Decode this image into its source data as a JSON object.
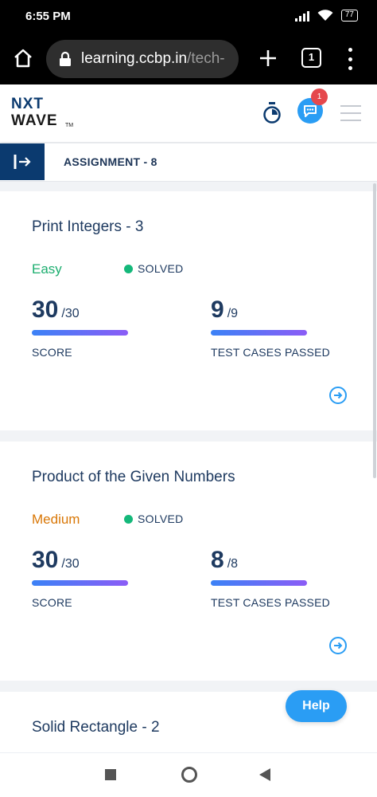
{
  "status_bar": {
    "time": "6:55 PM",
    "battery": "77"
  },
  "browser": {
    "url_main": "learning.ccbp.in",
    "url_rest": "/tech-",
    "tab_count": "1"
  },
  "app": {
    "logo_top": "NXT",
    "logo_bottom": "WAVE",
    "logo_tm": "TM",
    "notification_count": "1",
    "help_label": "Help"
  },
  "assignment": {
    "title": "ASSIGNMENT - 8"
  },
  "cards": [
    {
      "title": "Print Integers - 3",
      "difficulty": "Easy",
      "difficulty_color": "#1cae6f",
      "status": "SOLVED",
      "score": "30",
      "score_total": "/30",
      "score_label": "SCORE",
      "score_progress": 1,
      "tests": "9",
      "tests_total": "/9",
      "tests_label": "TEST CASES PASSED",
      "tests_progress": 1
    },
    {
      "title": "Product of the Given Numbers",
      "difficulty": "Medium",
      "difficulty_color": "#d97706",
      "status": "SOLVED",
      "score": "30",
      "score_total": "/30",
      "score_label": "SCORE",
      "score_progress": 1,
      "tests": "8",
      "tests_total": "/8",
      "tests_label": "TEST CASES PASSED",
      "tests_progress": 1
    },
    {
      "title": "Solid Rectangle - 2"
    }
  ],
  "colors": {
    "accent": "#2a9df4",
    "navy": "#0b3a6f",
    "text": "#1e3a60",
    "solved": "#14b87a"
  },
  "icons": [
    "home-icon",
    "lock-icon",
    "plus-icon",
    "tabs-icon",
    "more-vert-icon",
    "timer-icon",
    "chat-icon",
    "hamburger-icon",
    "sidebar-toggle-icon",
    "arrow-right-circle-icon"
  ]
}
